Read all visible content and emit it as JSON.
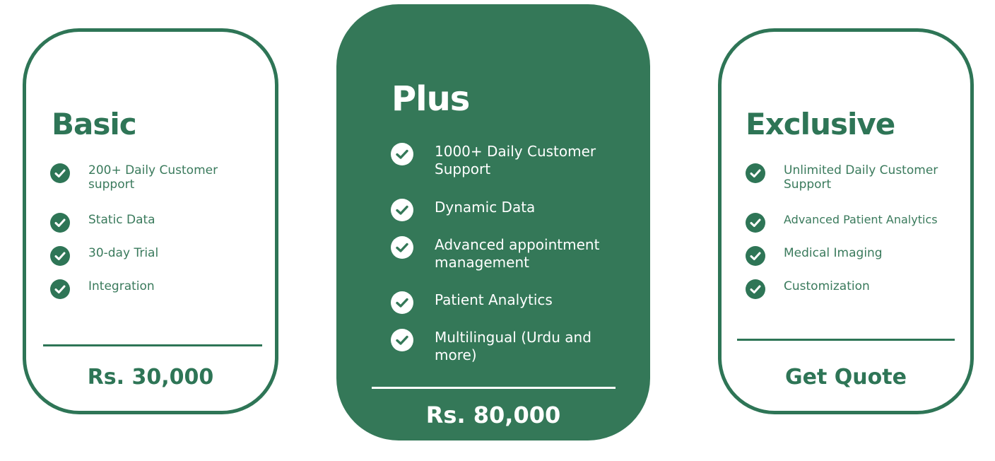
{
  "plans": {
    "basic": {
      "title": "Basic",
      "features": [
        "200+ Daily Customer support",
        "Static Data",
        "30-day Trial",
        "Integration"
      ],
      "price": "Rs. 30,000"
    },
    "plus": {
      "title": "Plus",
      "features": [
        "1000+ Daily Customer Support",
        "Dynamic Data",
        "Advanced appointment management",
        "Patient Analytics",
        "Multilingual (Urdu and more)"
      ],
      "price": "Rs. 80,000"
    },
    "exclusive": {
      "title": "Exclusive",
      "features": [
        "Unlimited Daily Customer Support",
        "Advanced Patient Analytics",
        "Medical Imaging",
        "Customization"
      ],
      "price": "Get Quote"
    }
  },
  "colors": {
    "brand_green": "#2e7556",
    "card_fill": "#347858",
    "text_on_fill": "#ffffff"
  },
  "icons": {
    "feature_bullet": "check-circle-icon"
  }
}
